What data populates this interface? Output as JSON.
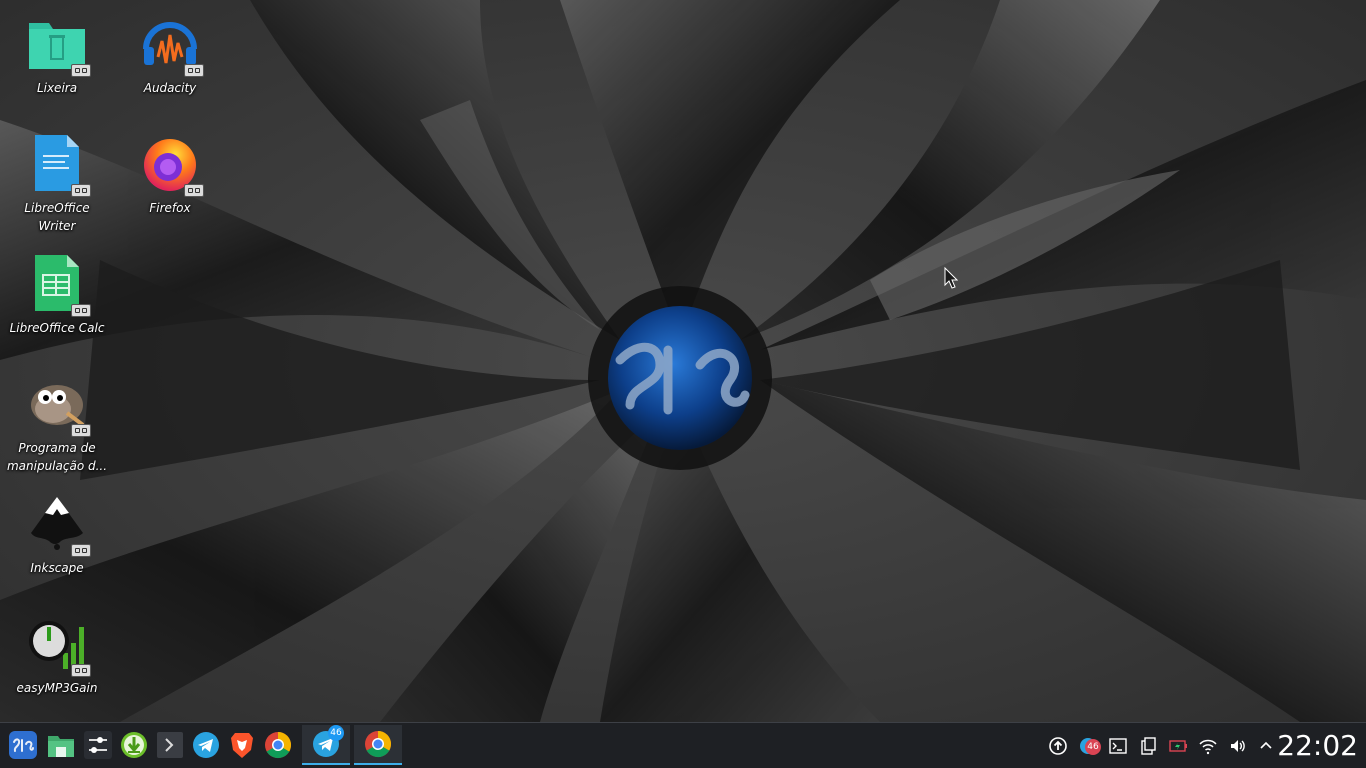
{
  "desktop": {
    "icons": [
      {
        "label": "Lixeira",
        "icon": "trash-icon"
      },
      {
        "label": "Audacity",
        "icon": "audacity-icon"
      },
      {
        "label": "LibreOffice Writer",
        "icon": "libreoffice-writer-icon"
      },
      {
        "label": "Firefox",
        "icon": "firefox-icon"
      },
      {
        "label": "LibreOffice Calc",
        "icon": "libreoffice-calc-icon"
      },
      {
        "label": "Programa de manipulação d...",
        "icon": "gimp-icon"
      },
      {
        "label": "Inkscape",
        "icon": "inkscape-icon"
      },
      {
        "label": "easyMP3Gain",
        "icon": "easymp3gain-icon"
      }
    ]
  },
  "taskbar": {
    "launchers": [
      {
        "name": "application-menu",
        "icon": "biglinux-logo-icon"
      },
      {
        "name": "file-manager",
        "icon": "folder-icon"
      },
      {
        "name": "settings",
        "icon": "sliders-icon"
      },
      {
        "name": "downloader",
        "icon": "download-icon"
      },
      {
        "name": "terminal",
        "icon": "terminal-icon"
      },
      {
        "name": "telegram",
        "icon": "telegram-icon"
      },
      {
        "name": "brave",
        "icon": "brave-icon"
      },
      {
        "name": "chrome",
        "icon": "chrome-icon"
      }
    ],
    "tasks": [
      {
        "name": "telegram-task",
        "icon": "telegram-icon",
        "badge": "46"
      },
      {
        "name": "chrome-task",
        "icon": "chrome-icon"
      }
    ],
    "tray": {
      "notification_badge": "46",
      "icons": [
        "update-icon",
        "notification-icon",
        "terminal-icon",
        "clipboard-icon",
        "battery-icon",
        "wifi-icon",
        "volume-icon",
        "chevron-up-icon"
      ]
    },
    "clock": "22:02"
  },
  "colors": {
    "taskbar_bg": "#1e2024",
    "accent": "#3daee9",
    "badge": "#1d99f3",
    "notification_red": "#da4453"
  }
}
